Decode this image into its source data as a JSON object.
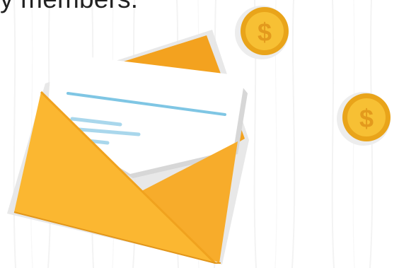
{
  "heading": {
    "text": "y members."
  },
  "envelope": {
    "icon": "open-envelope-with-letter",
    "body_color": "#FBB731",
    "flap_color": "#F6A723",
    "shadow_color": "#E8E8E8",
    "letter_color": "#FFFFFF",
    "letter_line_color": "#7FC6E4"
  },
  "coins": [
    {
      "icon": "dollar-coin-icon",
      "symbol": "$"
    },
    {
      "icon": "dollar-coin-icon",
      "symbol": "$"
    }
  ],
  "colors": {
    "coin_face": "#F7C034",
    "coin_rim": "#E9A41A",
    "coin_symbol": "#E39A1D",
    "coin_shadow": "#EDEDED"
  }
}
